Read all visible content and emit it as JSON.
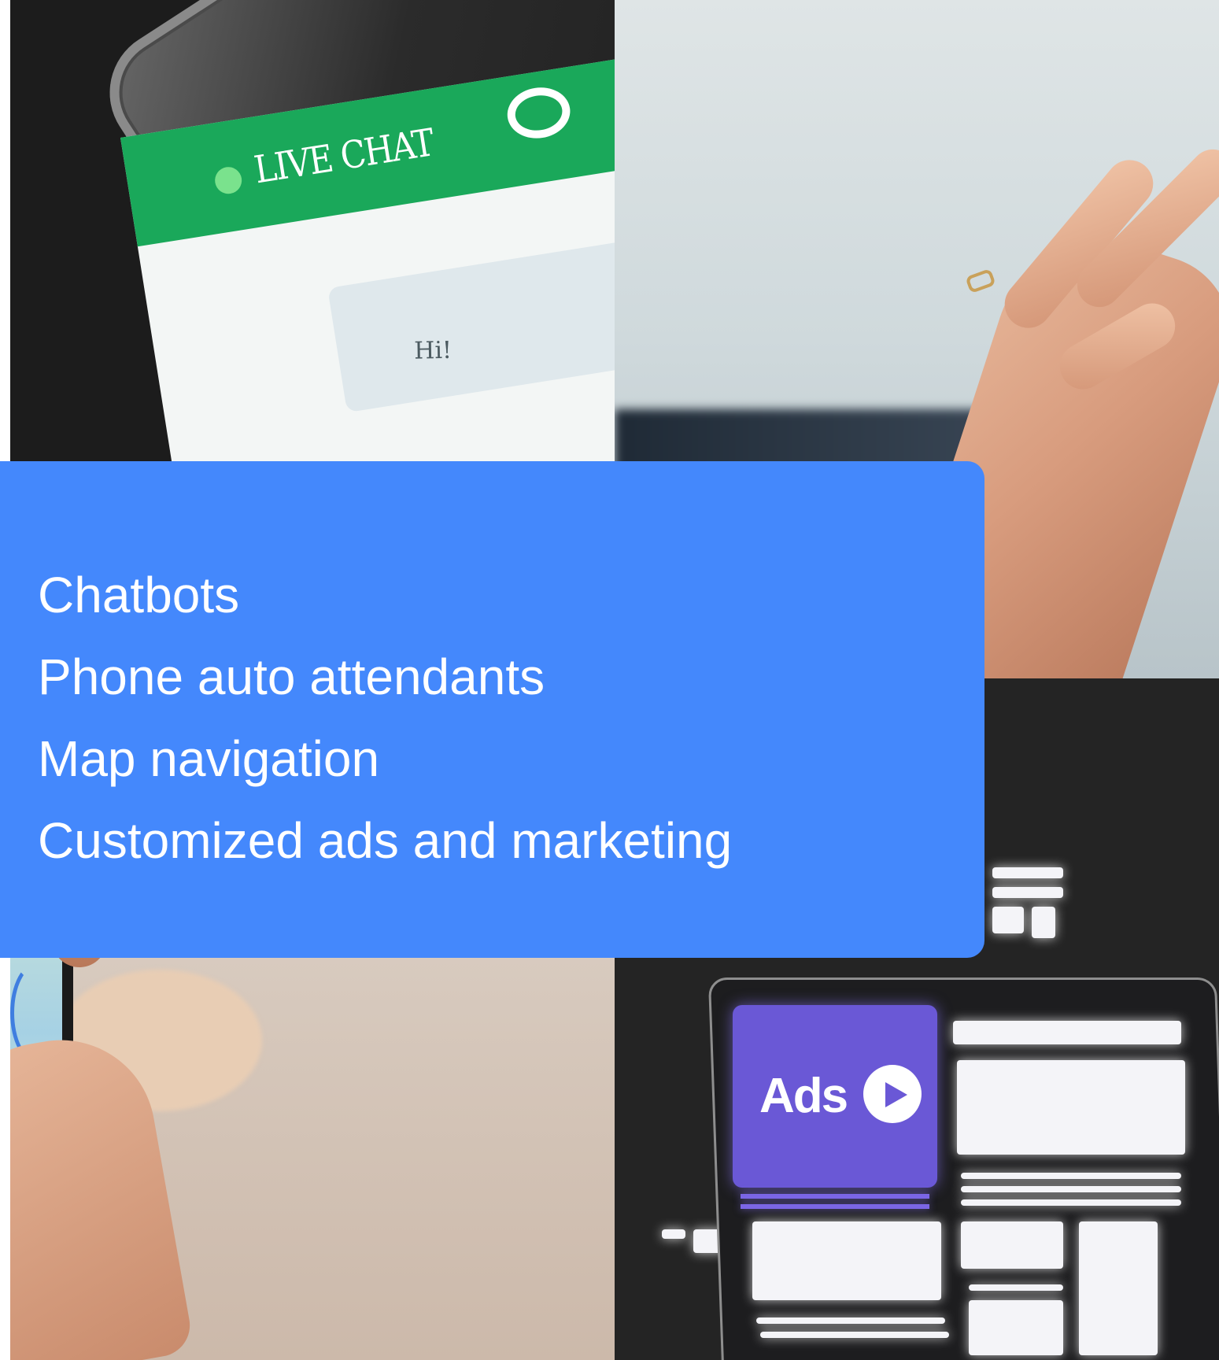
{
  "panel": {
    "items": [
      "Chatbots",
      "Phone auto attendants",
      "Map navigation",
      "Customized ads and marketing"
    ]
  },
  "photos": {
    "chat": {
      "header_label": "LIVE CHAT",
      "bubble_text": "Hi!"
    },
    "ads": {
      "card_label": "Ads"
    }
  },
  "colors": {
    "panel": "#4488fc",
    "panel_text": "#ffffff",
    "chat_green": "#1aa85a",
    "ads_purple": "#6a58d6"
  }
}
